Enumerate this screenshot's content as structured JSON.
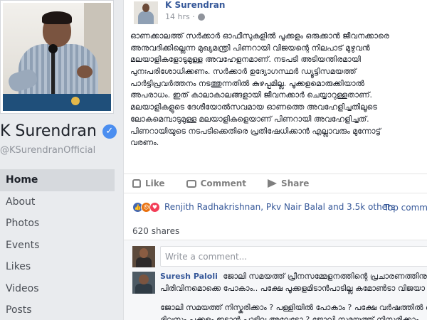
{
  "page": {
    "name": "K Surendran",
    "verified": true,
    "handle": "@KSurendranOfficial"
  },
  "left_nav": {
    "items": [
      {
        "label": "Home",
        "active": true
      },
      {
        "label": "About",
        "active": false
      },
      {
        "label": "Photos",
        "active": false
      },
      {
        "label": "Events",
        "active": false
      },
      {
        "label": "Likes",
        "active": false
      },
      {
        "label": "Videos",
        "active": false
      },
      {
        "label": "Posts",
        "active": false
      }
    ]
  },
  "post": {
    "author": "K Surendran",
    "time": "14 hrs ·",
    "privacy_icon": "globe-icon",
    "body_lines": [
      "ഓണക്കാലത്ത് സർക്കാർ ഓഫീസുകളിൽ പൂക്കളം ഒരുക്കാൻ ജീവനക്കാരെ",
      "അനുവദിക്കില്ലെന്ന മുഖ്യമന്ത്രി പിണറായി വിജയന്റെ നിലപാട് മുഴുവൻ",
      "മലയാളികളോടുമുള്ള അവഹേളനമാണ്. നടപടി അടിയന്തിരമായി",
      "പുനഃപരിശോധിക്കണം. സർക്കാർ ഉദ്യോഗസ്ഥർ ഡ്യൂട്ടിസമയത്ത്",
      "പാർട്ടിപ്രവർത്തനം നടത്തുന്നതിൽ കുഴപ്പമില്ല. പൂക്കളമൊരുക്കിയാൽ",
      "അപരാധം. ഇത് കാലാകാലങ്ങളായി ജീവനക്കാർ ചെയ്യാറുള്ളതാണ്.",
      "മലയാളികളുടെ ദേശീയോൽസവമായ ഓണത്തെ അവഹേളിച്ചതിലൂടെ",
      "ലോകമെമ്പാടുമുള്ള മലയാളികളെയാണ് പിണറായി അവഹേളിച്ചത്.",
      "പിണറായിയുടെ നടപടിക്കെതിരെ പ്രതിഷേധിക്കാൻ എല്ലാവരും മുന്നോട്ട്",
      "വരണം."
    ],
    "actions": {
      "like": "Like",
      "comment": "Comment",
      "share": "Share"
    },
    "reactions": {
      "types": [
        "like",
        "angry",
        "love"
      ],
      "reactors_text": "Renjith Radhakrishnan, Pkv Nair Balal and 3.5k others"
    },
    "top_comments_label": "Top comm",
    "shares": "620 shares"
  },
  "comment_box": {
    "placeholder": "Write a comment..."
  },
  "comments": [
    {
      "author": "Suresh Paloli",
      "text": "ജോലി സമയത്ത് പ്രീനസമ്മേളനത്തിന്റെ പ്രചാരണത്തിനും",
      "line2": "പിരിവിനമൊക്കെ പോകാം.. പക്ഷേ പൂക്കളമിടാൻപാടില്ല കമോൺടാ വിജയാ !"
    },
    {
      "lines": [
        "ജോലി സമയത്ത് നിസ്കരിക്കാം ? പള്ളിയിൽ പോകാം ? പക്ഷേ വർഷത്തിൽ ഒ",
        "ദിവസം പൂക്കളം ഇടാൻ പാടില്ല അല്ലേടോ ? ജോലി സമയത്ത് നിസ്കരിക്കാം"
      ]
    }
  ]
}
